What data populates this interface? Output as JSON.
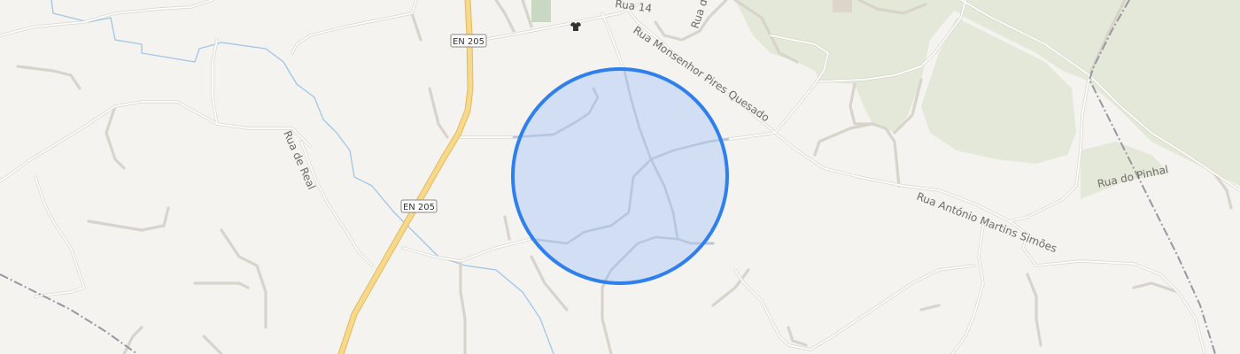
{
  "map": {
    "colors": {
      "background": "#f5f3ef",
      "forest": "#e3e8d8",
      "road": "#ffffff",
      "road_casing": "#d8d4cc",
      "highway": "#f6d98a",
      "highway_casing": "#e4b95e",
      "water": "#9fc6e8",
      "railway": "#9a97a3",
      "accuracy_fill": "#cddcf3",
      "accuracy_stroke": "#2f7fec"
    },
    "road_labels": {
      "rua_14": "Rua 14",
      "rua_d": "Rua d",
      "monsenhor": "Rua Monsenhor Pires Quesado",
      "real": "Rua de Real",
      "antonio": "Rua António Martins Simões",
      "pinhal": "Rua do Pinhal"
    },
    "shields": {
      "top": "EN 205",
      "middle": "EN 205"
    },
    "icons": {
      "poi": "clothes-shop-icon"
    },
    "location_marker": {
      "type": "accuracy-circle"
    }
  }
}
